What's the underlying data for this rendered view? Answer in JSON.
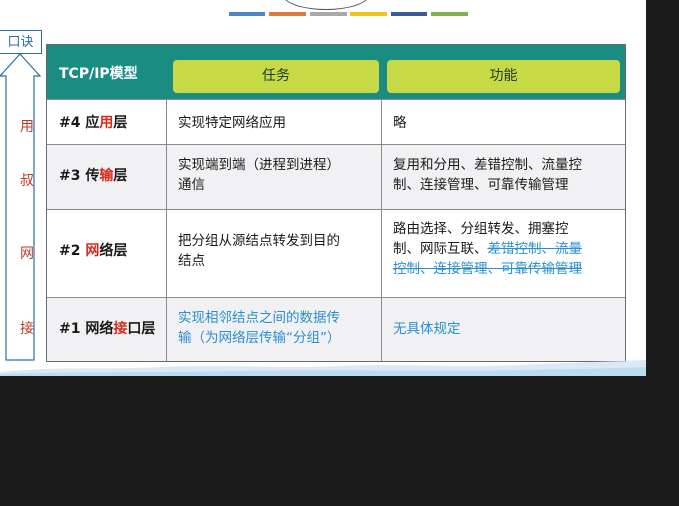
{
  "side": {
    "tab_label": "口诀",
    "mnemonic": [
      "用",
      "叔",
      "网",
      "接"
    ]
  },
  "colors": {
    "header_bg": "#1a8c82",
    "pill_bg": "#c7d944",
    "highlight_red": "#d62a1e",
    "note_blue": "#2a8fd0",
    "strip": [
      "#4f86c6",
      "#e07b39",
      "#a9a9a9",
      "#f0c419",
      "#3c5a99",
      "#7fb347"
    ]
  },
  "table": {
    "corner": "TCP/IP模型",
    "col_task": "任务",
    "col_func": "功能",
    "rows": [
      {
        "layer_pre": "#4 应",
        "layer_hl": "用",
        "layer_post": "层",
        "task": "实现特定网络应用",
        "func": "略"
      },
      {
        "layer_pre": "#3 传",
        "layer_hl": "输",
        "layer_post": "层",
        "task_l1": "实现端到端（进程到进程）",
        "task_l2": "通信",
        "func_l1": "复用和分用、差错控制、流量控",
        "func_l2": "制、连接管理、可靠传输管理"
      },
      {
        "layer_pre": "#2 ",
        "layer_hl": "网",
        "layer_post": "络层",
        "task_l1": "把分组从源结点转发到目的",
        "task_l2": "结点",
        "func_l1": "路由选择、分组转发、拥塞控",
        "func_l2_plain": "制、网际互联、",
        "func_l2_strike": "差错控制、流量",
        "func_l3_strike": "控制、连接管理、可靠传输管理"
      },
      {
        "layer_pre": "#1 网络",
        "layer_hl": "接",
        "layer_post": "口层",
        "task_l1": "实现相邻结点之间的数据传",
        "task_l2": "输（为网络层传输“分组”）",
        "func": "无具体规定"
      }
    ]
  }
}
